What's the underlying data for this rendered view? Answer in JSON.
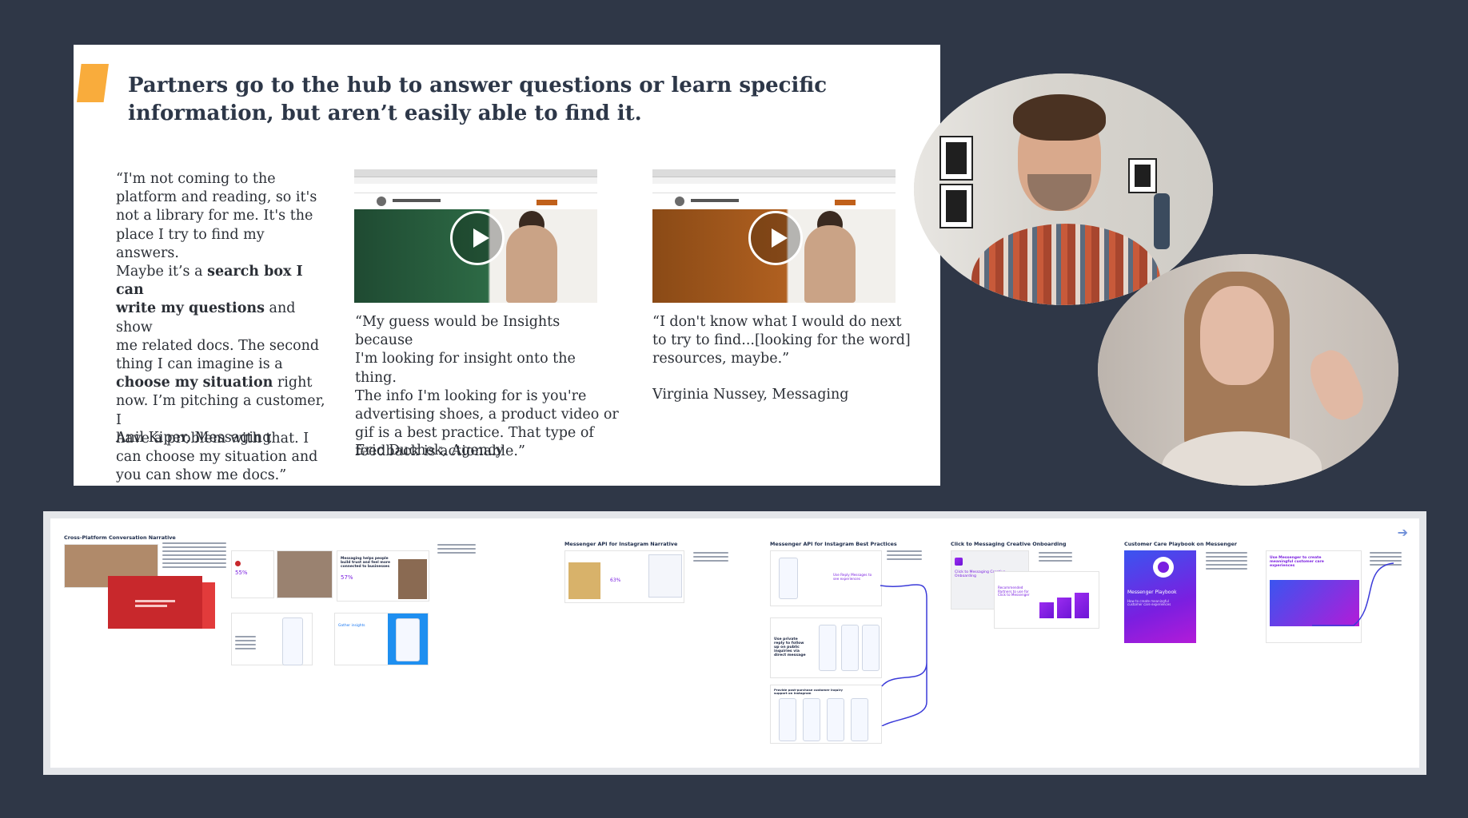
{
  "slide": {
    "title": "Partners go to the hub to answer questions or learn specific information, but aren’t easily able to find it.",
    "quotes": [
      {
        "lines": [
          [
            {
              "t": "“I'm not coming to the"
            }
          ],
          [
            {
              "t": "platform and reading, so it's"
            }
          ],
          [
            {
              "t": "not a library for me. It's the"
            }
          ],
          [
            {
              "t": "place I try to find my answers."
            }
          ],
          [
            {
              "t": "Maybe it’s a "
            },
            {
              "t": "search box I can",
              "b": true
            }
          ],
          [
            {
              "t": "write my questions",
              "b": true
            },
            {
              "t": " and show"
            }
          ],
          [
            {
              "t": "me related docs. The second"
            }
          ],
          [
            {
              "t": "thing I can imagine is a"
            }
          ],
          [
            {
              "t": "choose my situation",
              "b": true
            },
            {
              "t": " right"
            }
          ],
          [
            {
              "t": "now. I’m pitching a customer, I"
            }
          ],
          [
            {
              "t": "have a problem with that. I"
            }
          ],
          [
            {
              "t": "can choose my situation and"
            }
          ],
          [
            {
              "t": "you can show me docs.”"
            }
          ]
        ],
        "attribution": "Anil Kiper, Messaging"
      },
      {
        "lines": [
          [
            {
              "t": "“My guess would be Insights because"
            }
          ],
          [
            {
              "t": "I'm looking for insight onto the thing."
            }
          ],
          [
            {
              "t": "The info I'm looking for is you're"
            }
          ],
          [
            {
              "t": "advertising shoes, a product video or"
            }
          ],
          [
            {
              "t": "gif is a best practice. That type of"
            }
          ],
          [
            {
              "t": "feedback is actionable.”"
            }
          ]
        ],
        "attribution": "Eric Duchek, Agency"
      },
      {
        "lines": [
          [
            {
              "t": "“I don't know what I would do next"
            }
          ],
          [
            {
              "t": "to try to find...[looking for the word]"
            }
          ],
          [
            {
              "t": "resources, maybe.”"
            }
          ]
        ],
        "attribution": "Virginia Nussey, Messaging"
      }
    ],
    "videos": [
      {
        "hero_color": "#1f4a32",
        "hero_color_2": "#2d6a45"
      },
      {
        "hero_color": "#8a4a16",
        "hero_color_2": "#b06020"
      }
    ]
  },
  "board": {
    "sections": [
      {
        "title": "Cross-Platform Conversation Narrative"
      },
      {
        "title": "Messenger API for Instagram Narrative"
      },
      {
        "title": "Messenger API for Instagram Best Practices"
      },
      {
        "title": "Click to Messaging Creative Onboarding"
      },
      {
        "title": "Customer Care Playbook on Messenger"
      }
    ],
    "cards": {
      "stat_55": "55%",
      "stat_57": "57%",
      "stat_63": "63%",
      "messaging_helps": "Messaging helps people build trust and feel more connected to businesses",
      "gather_insights": "Gather insights",
      "use_reply": "Use Reply Messages to see experiences",
      "use_private_reply": "Use private reply to follow up on public inquiries via direct message",
      "provide_support": "Provide post-purchase customer inquiry support on Instagram",
      "click_to_messaging": "Click to Messaging Creative Onboarding",
      "recommended": "Recommended Partners to use for Click to Messenger",
      "playbook_title": "Messenger Playbook",
      "playbook_sub": "How to create meaningful customer care experiences",
      "use_messenger": "Use Messenger to create meaningful customer care experiences"
    }
  },
  "colors": {
    "background": "#2f3747",
    "accent_marker": "#f9ac3c",
    "title_text": "#2d3748",
    "messenger_purple": "#7a1fe0",
    "connector_blue": "#3b3bd9"
  }
}
